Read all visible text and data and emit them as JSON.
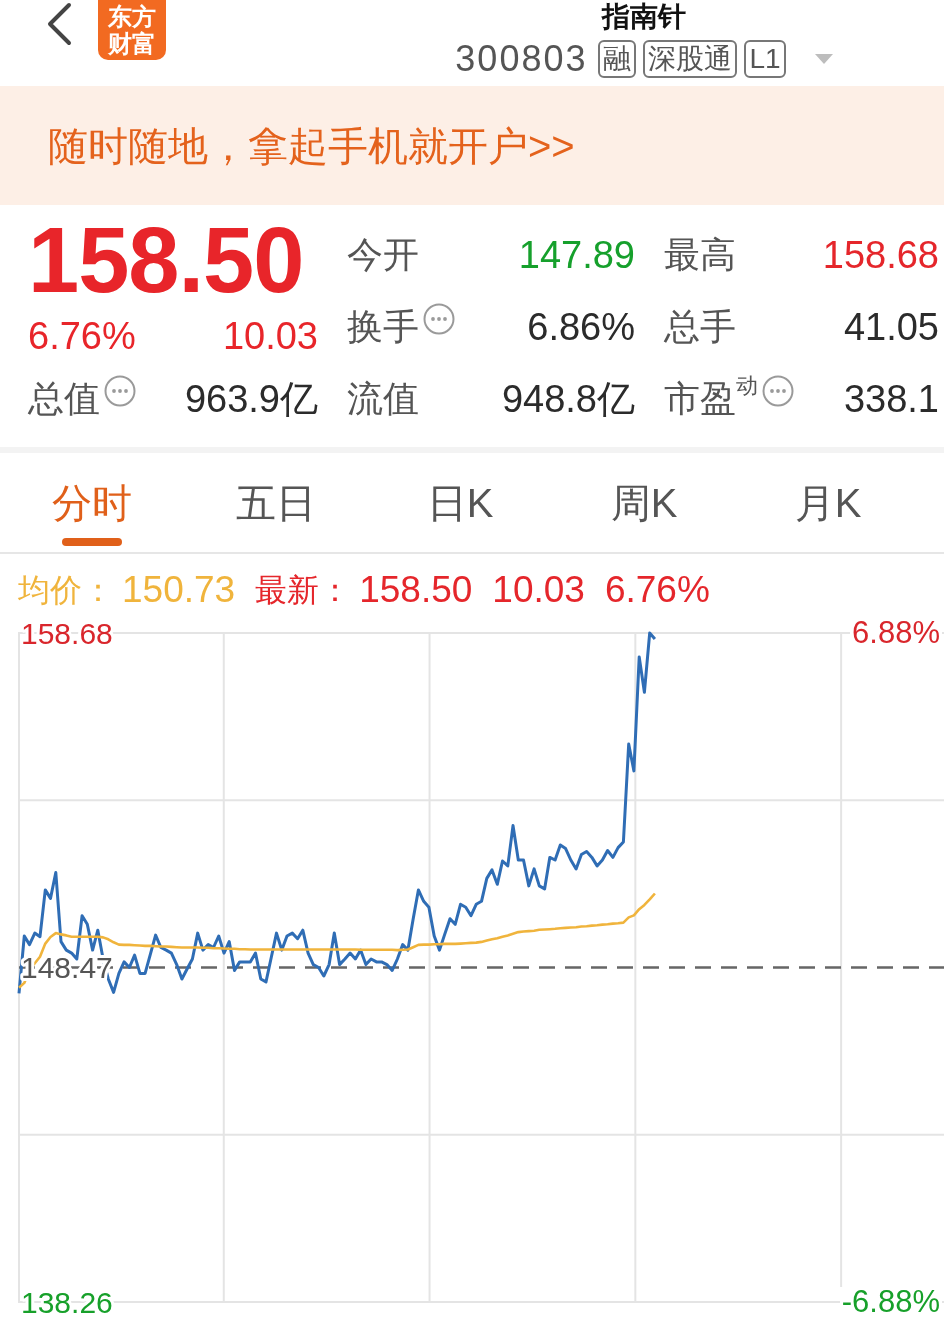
{
  "header": {
    "title": "指南针",
    "logo": "东方财富",
    "code": "300803",
    "tags": [
      "融",
      "深股通",
      "L1"
    ]
  },
  "banner": {
    "text": "随时随地，拿起手机就开户>>"
  },
  "quote": {
    "price": "158.50",
    "change_pct": "6.76%",
    "change": "10.03",
    "stats": [
      {
        "label": "今开",
        "info": false,
        "value": "147.89",
        "color": "#16a02c"
      },
      {
        "label": "最高",
        "info": false,
        "value": "158.68",
        "color": "#e5262b"
      },
      {
        "label": "换手",
        "info": true,
        "value": "6.86%",
        "color": "#2b2b2b"
      },
      {
        "label": "总手",
        "info": false,
        "value": "41.05",
        "color": "#2b2b2b"
      },
      {
        "label": "总值",
        "info": true,
        "value": "963.9亿",
        "color": "#2b2b2b"
      },
      {
        "label": "流值",
        "info": false,
        "value": "948.8亿",
        "color": "#2b2b2b"
      },
      {
        "label": "市盈$^{动}$",
        "info": true,
        "value": "338.1",
        "color": "#2b2b2b"
      }
    ]
  },
  "tabs": [
    {
      "label": "分时",
      "selected": true
    },
    {
      "label": "五日",
      "selected": false
    },
    {
      "label": "日K",
      "selected": false
    },
    {
      "label": "周K",
      "selected": false
    },
    {
      "label": "月K",
      "selected": false
    }
  ],
  "legend": [
    {
      "label": "均价：",
      "values": [
        "150.73"
      ],
      "color": "#f0b43c"
    },
    {
      "label": "最新：",
      "values": [
        "158.50",
        "10.03",
        "6.76%"
      ],
      "color": "#e5262b"
    }
  ],
  "chart": {
    "right_labels": [
      {
        "text": "6.88%",
        "color": "#d9262c"
      },
      {
        "text": "-6.88%",
        "color": "#17a02a"
      }
    ],
    "chart_data": {
      "type": "line",
      "ylim": [
        138.26,
        158.68
      ],
      "yticks": [
        138.26,
        148.47,
        158.68
      ],
      "ref_lines": [
        {
          "axis": "y",
          "value": 148.47
        }
      ],
      "categories": [
        null,
        null,
        null,
        null,
        null,
        null,
        null,
        null,
        null,
        null,
        null,
        null,
        null,
        null,
        null,
        null,
        null,
        null,
        null,
        null,
        null,
        null,
        null,
        null,
        null,
        null,
        null,
        null,
        null,
        null,
        null,
        null,
        null,
        null,
        null,
        null,
        null,
        null,
        null,
        null,
        null,
        null,
        null,
        null,
        null,
        null,
        null,
        null,
        null,
        null,
        null,
        null,
        null,
        null,
        null,
        null,
        null,
        null,
        null,
        null,
        null,
        null,
        null,
        null,
        null,
        null,
        null,
        null,
        null,
        null,
        null,
        null,
        null,
        null,
        null,
        null,
        null,
        null,
        null,
        null,
        null,
        null,
        null,
        null,
        null,
        null,
        null,
        null,
        null,
        null,
        null,
        null,
        null,
        null,
        null,
        null,
        null,
        null,
        null,
        null,
        null,
        null,
        null,
        null,
        null,
        null,
        null,
        null,
        null,
        null,
        null,
        null,
        null,
        null,
        null,
        null,
        null,
        null,
        null,
        null,
        null,
        null,
        null,
        null,
        null,
        null,
        null,
        null,
        null,
        null,
        null,
        null,
        null,
        null,
        null,
        null,
        null,
        null,
        null,
        null,
        null,
        null,
        null,
        null,
        null,
        null,
        null,
        null,
        null,
        null,
        null,
        null,
        null,
        null,
        null,
        null,
        null,
        null,
        null,
        null,
        null,
        null,
        null,
        null,
        null,
        null,
        null,
        null,
        null,
        null,
        null,
        null,
        null,
        null,
        null,
        null,
        null
      ],
      "series": [
        {
          "color": "#2f6db5",
          "values": [
            147.68,
            149.43,
            149.17,
            149.52,
            149.41,
            150.84,
            150.58,
            151.37,
            149.26,
            149.0,
            148.91,
            148.73,
            150.05,
            149.79,
            149.0,
            149.61,
            148.73,
            148.12,
            147.71,
            148.29,
            148.64,
            148.47,
            148.85,
            148.29,
            148.29,
            148.88,
            149.46,
            149.08,
            149.0,
            148.91,
            148.56,
            148.12,
            148.43,
            148.73,
            149.52,
            149.0,
            149.17,
            149.08,
            149.43,
            148.91,
            149.26,
            148.38,
            148.64,
            148.64,
            148.64,
            148.91,
            148.12,
            148.03,
            148.78,
            149.52,
            149.0,
            149.43,
            149.52,
            149.35,
            149.61,
            148.91,
            148.56,
            148.47,
            148.21,
            148.56,
            149.52,
            148.56,
            148.73,
            148.91,
            148.73,
            149.0,
            148.56,
            148.73,
            148.64,
            148.64,
            148.56,
            148.38,
            148.73,
            149.17,
            149.0,
            149.96,
            150.84,
            150.49,
            150.31,
            149.43,
            149.0,
            149.48,
            149.96,
            149.79,
            150.4,
            150.31,
            150.05,
            150.4,
            150.49,
            151.19,
            151.45,
            151.01,
            151.72,
            151.57,
            152.8,
            151.75,
            151.75,
            150.96,
            151.48,
            150.96,
            150.87,
            151.83,
            151.75,
            152.21,
            152.1,
            151.75,
            151.48,
            151.92,
            152.01,
            151.83,
            151.57,
            151.75,
            152.04,
            151.83,
            152.13,
            152.3,
            155.29,
            154.47,
            157.95,
            156.87,
            158.68,
            158.5,
            null,
            null,
            null,
            null,
            null,
            null,
            null,
            null,
            null,
            null,
            null,
            null,
            null,
            null,
            null,
            null,
            null,
            null,
            null,
            null,
            null,
            null,
            null,
            null,
            null,
            null,
            null,
            null,
            null,
            null,
            null,
            null,
            null,
            null,
            null,
            null,
            null,
            null,
            null,
            null,
            null,
            null,
            null,
            null,
            null,
            null,
            null,
            null,
            null,
            null,
            null,
            null,
            null,
            null,
            null
          ]
        },
        {
          "color": "#f0b43c",
          "values": [
            147.85,
            148.0,
            148.4,
            148.6,
            148.8,
            149.2,
            149.4,
            149.52,
            149.48,
            149.45,
            149.41,
            149.41,
            149.41,
            149.41,
            149.41,
            149.41,
            149.39,
            149.33,
            149.24,
            149.17,
            149.16,
            149.16,
            149.15,
            149.14,
            149.13,
            149.13,
            149.12,
            149.11,
            149.11,
            149.1,
            149.09,
            149.08,
            149.08,
            149.08,
            149.08,
            149.07,
            149.07,
            149.06,
            149.06,
            149.05,
            149.04,
            149.04,
            149.03,
            149.03,
            149.02,
            149.02,
            149.02,
            149.02,
            149.02,
            149.02,
            149.02,
            149.02,
            149.02,
            149.02,
            149.02,
            149.02,
            149.02,
            149.02,
            149.02,
            149.02,
            149.02,
            149.02,
            149.02,
            149.02,
            149.02,
            149.01,
            149.01,
            149.01,
            149.01,
            149.01,
            149.01,
            149.01,
            149.0,
            149.01,
            149.02,
            149.09,
            149.16,
            149.17,
            149.17,
            149.18,
            149.18,
            149.19,
            149.19,
            149.19,
            149.2,
            149.21,
            149.22,
            149.23,
            149.25,
            149.29,
            149.33,
            149.36,
            149.41,
            149.45,
            149.5,
            149.55,
            149.57,
            149.58,
            149.59,
            149.62,
            149.63,
            149.64,
            149.65,
            149.67,
            149.68,
            149.69,
            149.7,
            149.72,
            149.73,
            149.75,
            149.76,
            149.78,
            149.79,
            149.81,
            149.82,
            149.84,
            150.0,
            150.06,
            150.25,
            150.38,
            150.55,
            150.73,
            null,
            null,
            null,
            null,
            null,
            null,
            null,
            null,
            null,
            null,
            null,
            null,
            null,
            null,
            null,
            null,
            null,
            null,
            null,
            null,
            null,
            null,
            null,
            null,
            null,
            null,
            null,
            null,
            null,
            null,
            null,
            null,
            null,
            null,
            null,
            null,
            null,
            null,
            null,
            null,
            null,
            null,
            null,
            null,
            null,
            null,
            null,
            null,
            null,
            null,
            null,
            null,
            null,
            null,
            null
          ]
        }
      ]
    }
  }
}
